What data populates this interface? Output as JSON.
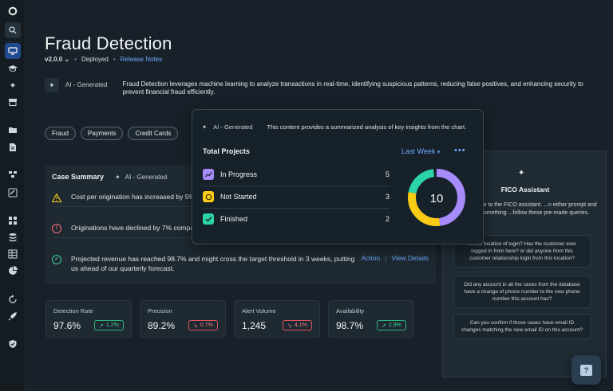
{
  "header": {
    "title": "Fraud Detection",
    "version": "v2.0.0",
    "status": "Deployed",
    "release_notes": "Release Notes"
  },
  "ai_summary": {
    "label": "AI - Generated",
    "text": "Fraud Detection leverages machine learning to analyze transactions in real-time, identifying suspicious patterns, reducing false positives, and enhancing security to prevent financial fraud efficiently."
  },
  "tags": [
    "Fraud",
    "Payments",
    "Credit Cards"
  ],
  "case_summary": {
    "title": "Case Summary",
    "ai_label": "AI - Generated",
    "rows": [
      {
        "text": "Cost per origination has increased by 5% c... control measures required immediately.",
        "status": "warning"
      },
      {
        "text": "Originations have declined by 7% compar... corrective action recommended.",
        "status": "error"
      },
      {
        "text": "Projected revenue has reached 98.7% and might cross the target threshold in 3 weeks, putting us ahead of our quarterly forecast.",
        "status": "success"
      }
    ],
    "action_label": "Action",
    "view_details_label": "View Details"
  },
  "metrics": [
    {
      "label": "Detection Rate",
      "value": "97.6%",
      "delta": "1.2%",
      "trend": "up"
    },
    {
      "label": "Precision",
      "value": "89.2%",
      "delta": "0.7%",
      "trend": "down"
    },
    {
      "label": "Alert Volume",
      "value": "1,245",
      "delta": "4.1%",
      "trend": "down"
    },
    {
      "label": "Availability",
      "value": "98.7%",
      "delta": "2.9%",
      "trend": "up"
    }
  ],
  "projects_popup": {
    "ai_label": "AI - Generated",
    "description": "This  content provides a summarized analysis of key insights from the chart.",
    "title": "Total Projects",
    "period": "Last Week",
    "rows": [
      {
        "label": "In Progress",
        "count": "5"
      },
      {
        "label": "Not Started",
        "count": "3"
      },
      {
        "label": "Finished",
        "count": "2"
      }
    ],
    "total": "10"
  },
  "chart_data": {
    "type": "pie",
    "title": "",
    "categories": [
      "In Progress",
      "Not Started",
      "Finished"
    ],
    "values": [
      5,
      3,
      2
    ],
    "center_label": "10",
    "colors": [
      "#a78bfa",
      "#facc15",
      "#2dd4a7"
    ]
  },
  "fico": {
    "title": "FICO Assistant",
    "subtitle": "...o, welcome to the FICO assistant. ...n either prompt and ask me something ...follow these pre-made queries.",
    "queries": [
      "...t the location of login? Has the customer ever logged in from here? or did anyone from this customer relationship login from this location?",
      "Did any account in all the cases from the database have a change of phone number to the new phone number this account has?",
      "Can you confirm if those cases have email ID changes matching the new email ID on this account?"
    ]
  },
  "colors": {
    "accent": "#6fa8ff",
    "positive": "#3fd195",
    "negative": "#ff7d84",
    "warning": "#facc15"
  }
}
